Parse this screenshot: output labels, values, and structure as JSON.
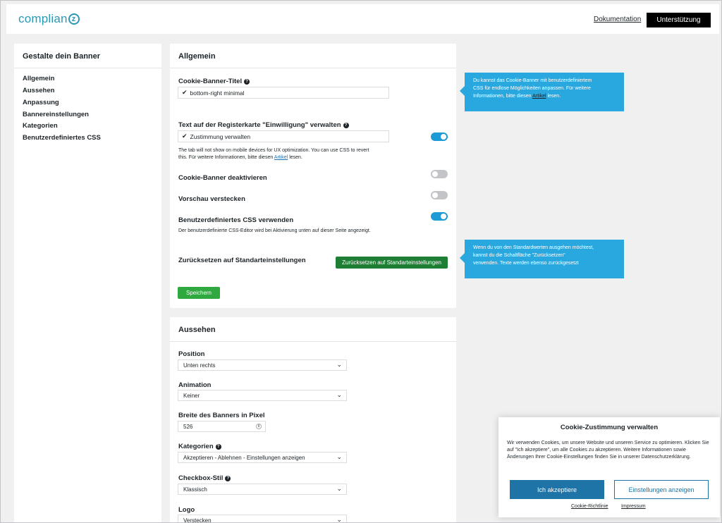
{
  "header": {
    "logo_text": "complian",
    "logo_mark": "z",
    "doc_link": "Dokumentation",
    "support_button": "Unterstützung"
  },
  "sidebar": {
    "title": "Gestalte dein Banner",
    "items": [
      "Allgemein",
      "Aussehen",
      "Anpassung",
      "Bannereinstellungen",
      "Kategorien",
      "Benutzerdefiniertes CSS"
    ]
  },
  "general": {
    "title": "Allgemein",
    "banner_title_label": "Cookie-Banner-Titel",
    "banner_title_value": "bottom-right minimal",
    "tab_label": "Text auf der Registerkarte \"Einwilligung\" verwalten",
    "tab_value": "Zustimmung verwalten",
    "tab_note_1": "The tab will not show on mobile devices for UX optimization. You can use CSS to revert",
    "tab_note_2": "this. Für weitere Informationen, bitte diesen",
    "tab_note_link": "Artikel",
    "tab_note_end": "lesen.",
    "tab_toggle": true,
    "disable_label": "Cookie-Banner deaktivieren",
    "disable_toggle": false,
    "hide_preview_label": "Vorschau verstecken",
    "hide_preview_toggle": false,
    "custom_css_label": "Benutzerdefiniertes CSS verwenden",
    "custom_css_toggle": true,
    "custom_css_note": "Der benutzerdefinierte CSS-Editor wird bei Aktivierung unten auf dieser Seite angezeigt.",
    "reset_label": "Zurücksetzen auf Standarteinstellungen",
    "reset_button": "Zurücksetzen auf Standarteinstellungen",
    "save_button": "Speichern"
  },
  "appearance": {
    "title": "Aussehen",
    "position_label": "Position",
    "position_value": "Unten rechts",
    "animation_label": "Animation",
    "animation_value": "Keiner",
    "width_label": "Breite des Banners in Pixel",
    "width_value": "526",
    "categories_label": "Kategorien",
    "categories_value": "Akzeptieren - Ablehnen - Einstellungen anzeigen",
    "checkbox_label": "Checkbox-Stil",
    "checkbox_value": "Klassisch",
    "logo_label": "Logo",
    "logo_value": "Verstecken"
  },
  "tooltips": {
    "css_1": "Du kannst das Cookie-Banner mit benutzerdefiniertem",
    "css_2": "CSS für endlose Möglichkeiten anpassen. Für weitere",
    "css_3": "Informationen, bitte diesen",
    "css_link": "Artikel",
    "css_end": "lesen.",
    "reset_1": "Wenn du von den Standardwerten ausgehen möchtest,",
    "reset_2": "kannst du die Schaltfläche \"Zurücksetzen\"",
    "reset_3": "verwenden. Texte werden ebenso zurückgesetzt"
  },
  "cookie_banner": {
    "title": "Cookie-Zustimmung verwalten",
    "text": "Wir verwenden Cookies, um unsere Website und unseren Service zu optimieren. Klicken Sie auf \"Ich akzeptiere\", um alle Cookies zu akzeptieren. Weitere Informationen sowie Änderungen Ihrer Cookie-Einstellungen finden Sie in unserer Datenschutzerklärung.",
    "accept_button": "Ich akzeptiere",
    "settings_button": "Einstellungen anzeigen",
    "policy_link": "Cookie-Richtlinie",
    "imprint_link": "Impressum"
  },
  "colors": {
    "brand": "#2a98b5",
    "toggle_on": "#1e9bd7",
    "tooltip": "#29a8e0",
    "reset_button": "#1e7e34",
    "save_button": "#2ea83f",
    "cookie_accept": "#1e73a7"
  },
  "icons": [
    "help-icon",
    "checkmark-icon",
    "chevron-down-icon",
    "spinner-icon"
  ]
}
